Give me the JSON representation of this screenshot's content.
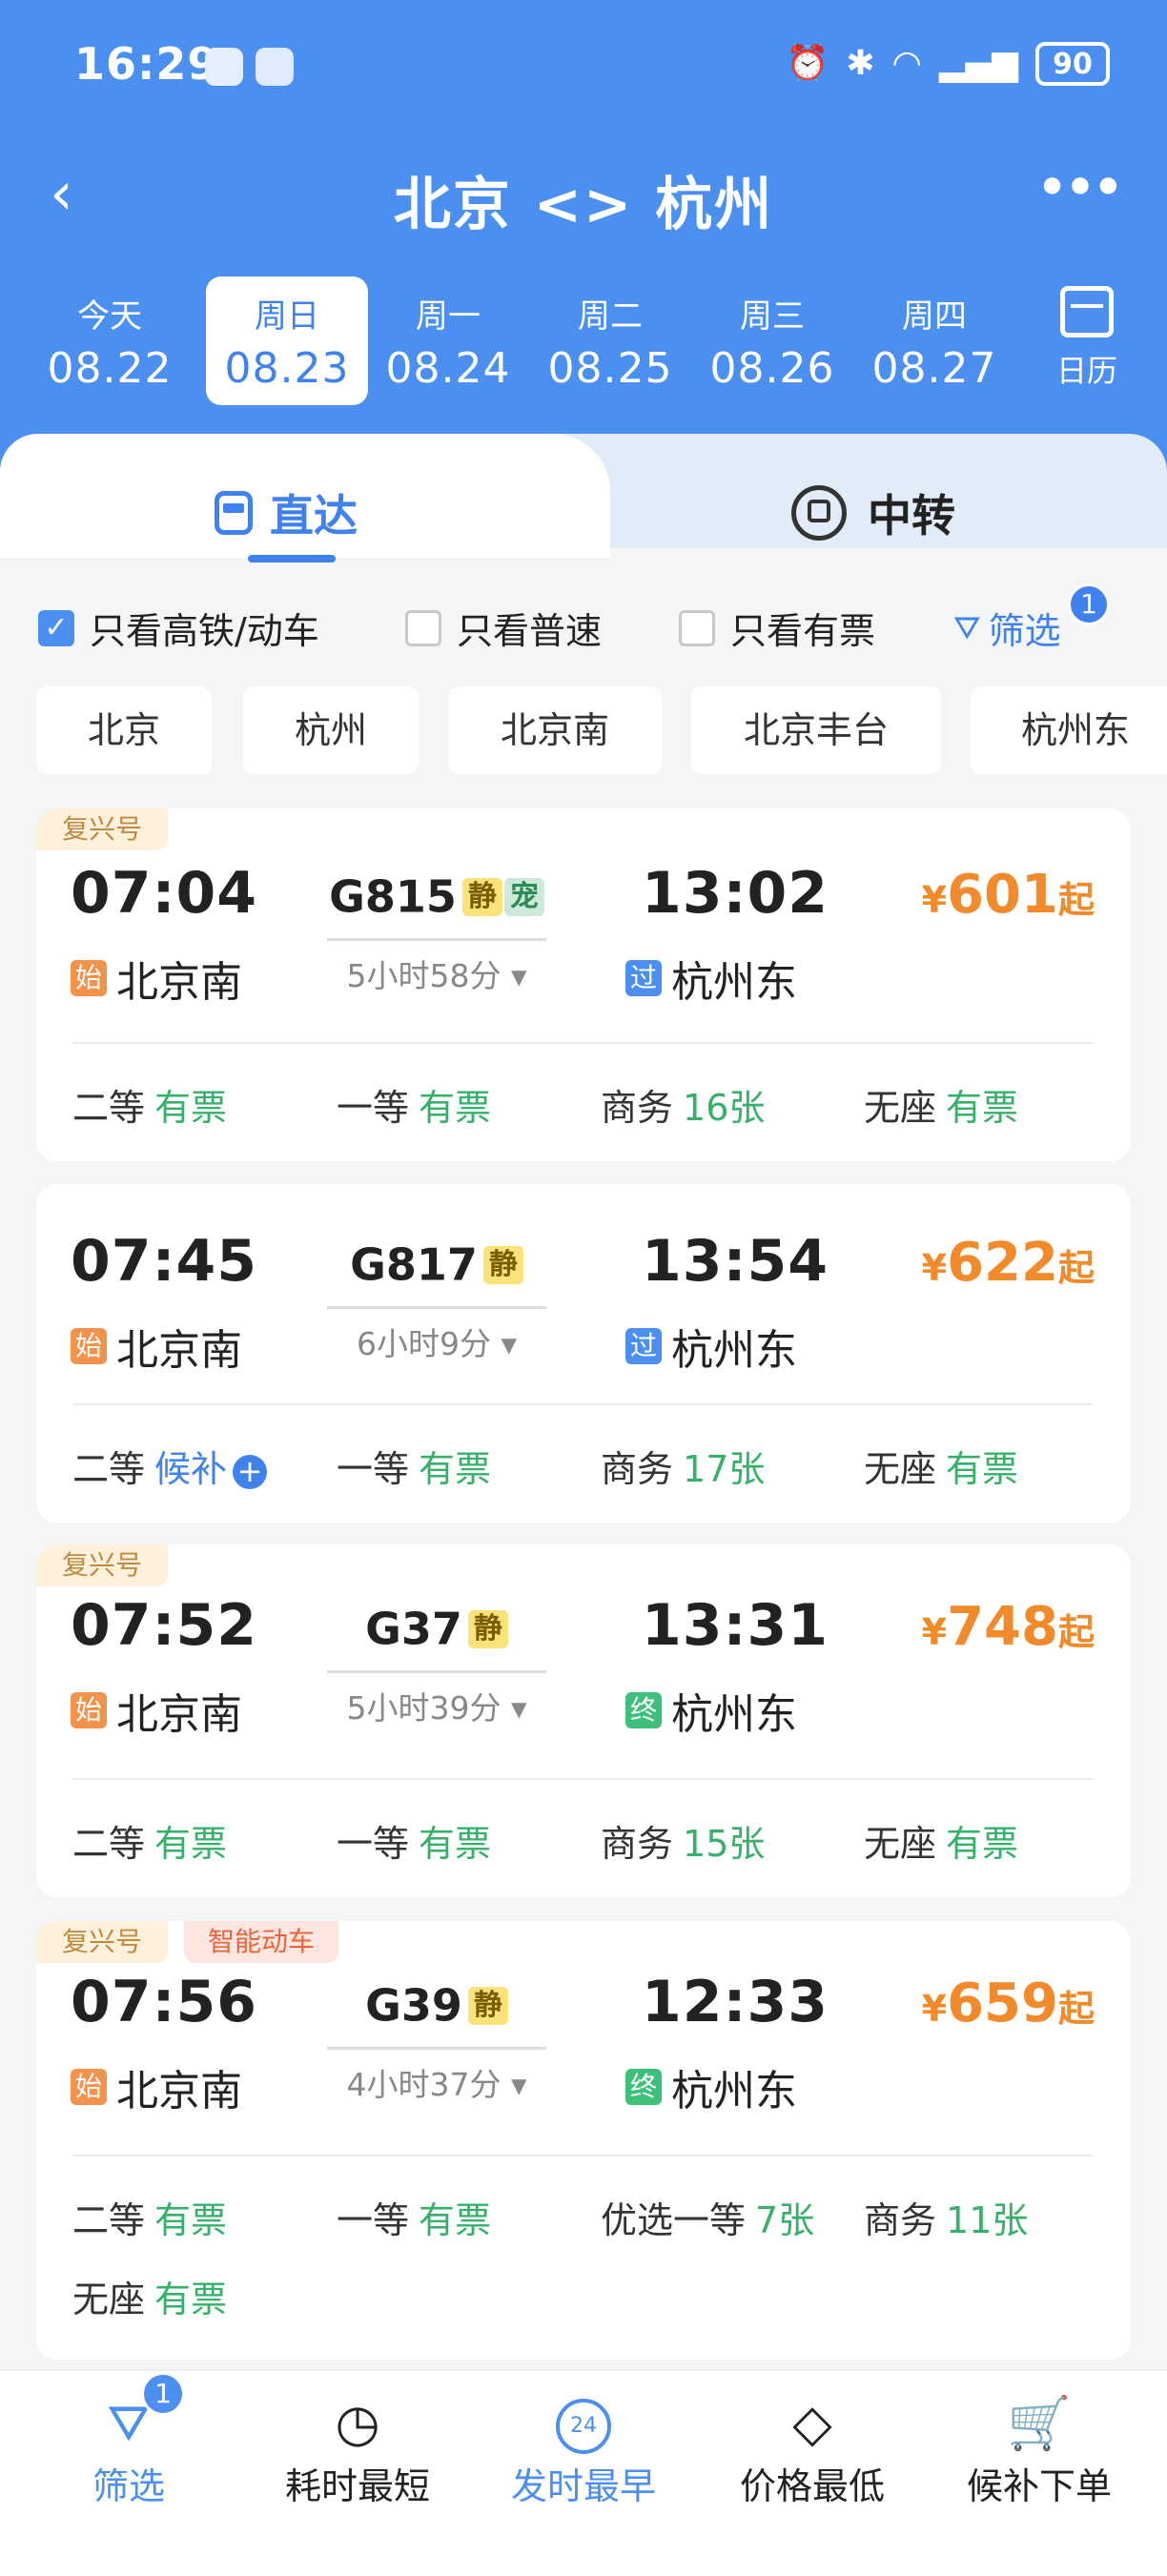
{
  "status_bar": {
    "time": "16:29",
    "battery": "90",
    "icons": [
      "alarm-icon",
      "bluetooth-icon",
      "wifi-icon",
      "5g-signal-icon"
    ]
  },
  "header": {
    "back_icon": "‹",
    "title": "北京 <> 杭州",
    "more_icon": "•••"
  },
  "dates": [
    {
      "weekday": "今天",
      "date": "08.22"
    },
    {
      "weekday": "周日",
      "date": "08.23"
    },
    {
      "weekday": "周一",
      "date": "08.24"
    },
    {
      "weekday": "周二",
      "date": "08.25"
    },
    {
      "weekday": "周三",
      "date": "08.26"
    },
    {
      "weekday": "周四",
      "date": "08.27"
    }
  ],
  "calendar_label": "日历",
  "tabs": {
    "direct": "直达",
    "transfer": "中转"
  },
  "filters": {
    "high_speed": "只看高铁/动车",
    "normal": "只看普速",
    "has_ticket": "只看有票",
    "filter_label": "筛选",
    "filter_count": "1"
  },
  "stations": [
    "北京",
    "杭州",
    "北京南",
    "北京丰台",
    "杭州东"
  ],
  "trains": [
    {
      "tag": "复兴号",
      "tag2": "",
      "dep_time": "07:04",
      "train_no": "G815",
      "quiet_tag": "静",
      "pet_tag": "宠",
      "arr_time": "13:02",
      "duration": "5小时58分 ▾",
      "dep_badge": "始",
      "dep_station": "北京南",
      "arr_badge": "过",
      "arr_station": "杭州东",
      "price_symbol": "¥",
      "price": "601",
      "price_suffix": "起",
      "seats": [
        {
          "name": "二等",
          "status": "有票"
        },
        {
          "name": "一等",
          "status": "有票"
        },
        {
          "name": "商务",
          "status": "16张"
        },
        {
          "name": "无座",
          "status": "有票"
        }
      ]
    },
    {
      "tag": "",
      "tag2": "",
      "dep_time": "07:45",
      "train_no": "G817",
      "quiet_tag": "静",
      "pet_tag": "",
      "arr_time": "13:54",
      "duration": "6小时9分 ▾",
      "dep_badge": "始",
      "dep_station": "北京南",
      "arr_badge": "过",
      "arr_station": "杭州东",
      "price_symbol": "¥",
      "price": "622",
      "price_suffix": "起",
      "seats": [
        {
          "name": "二等",
          "status": "候补"
        },
        {
          "name": "一等",
          "status": "有票"
        },
        {
          "name": "商务",
          "status": "17张"
        },
        {
          "name": "无座",
          "status": "有票"
        }
      ]
    },
    {
      "tag": "复兴号",
      "tag2": "",
      "dep_time": "07:52",
      "train_no": "G37",
      "quiet_tag": "静",
      "pet_tag": "",
      "arr_time": "13:31",
      "duration": "5小时39分 ▾",
      "dep_badge": "始",
      "dep_station": "北京南",
      "arr_badge": "终",
      "arr_station": "杭州东",
      "price_symbol": "¥",
      "price": "748",
      "price_suffix": "起",
      "seats": [
        {
          "name": "二等",
          "status": "有票"
        },
        {
          "name": "一等",
          "status": "有票"
        },
        {
          "name": "商务",
          "status": "15张"
        },
        {
          "name": "无座",
          "status": "有票"
        }
      ]
    },
    {
      "tag": "复兴号",
      "tag2": "智能动车",
      "dep_time": "07:56",
      "train_no": "G39",
      "quiet_tag": "静",
      "pet_tag": "",
      "arr_time": "12:33",
      "duration": "4小时37分 ▾",
      "dep_badge": "始",
      "dep_station": "北京南",
      "arr_badge": "终",
      "arr_station": "杭州东",
      "price_symbol": "¥",
      "price": "659",
      "price_suffix": "起",
      "seats": [
        {
          "name": "二等",
          "status": "有票"
        },
        {
          "name": "一等",
          "status": "有票"
        },
        {
          "name": "优选一等",
          "status": "7张"
        },
        {
          "name": "商务",
          "status": "11张"
        },
        {
          "name": "无座",
          "status": "有票"
        }
      ]
    }
  ],
  "bottom_bar": {
    "filter": "筛选",
    "filter_badge": "1",
    "shortest": "耗时最短",
    "earliest": "发时最早",
    "earliest_icon_text": "24",
    "cheapest": "价格最低",
    "waitlist": "候补下单"
  },
  "colors": {
    "primary": "#4b8ff0",
    "price": "#f08a2a",
    "available": "#36b06a"
  }
}
